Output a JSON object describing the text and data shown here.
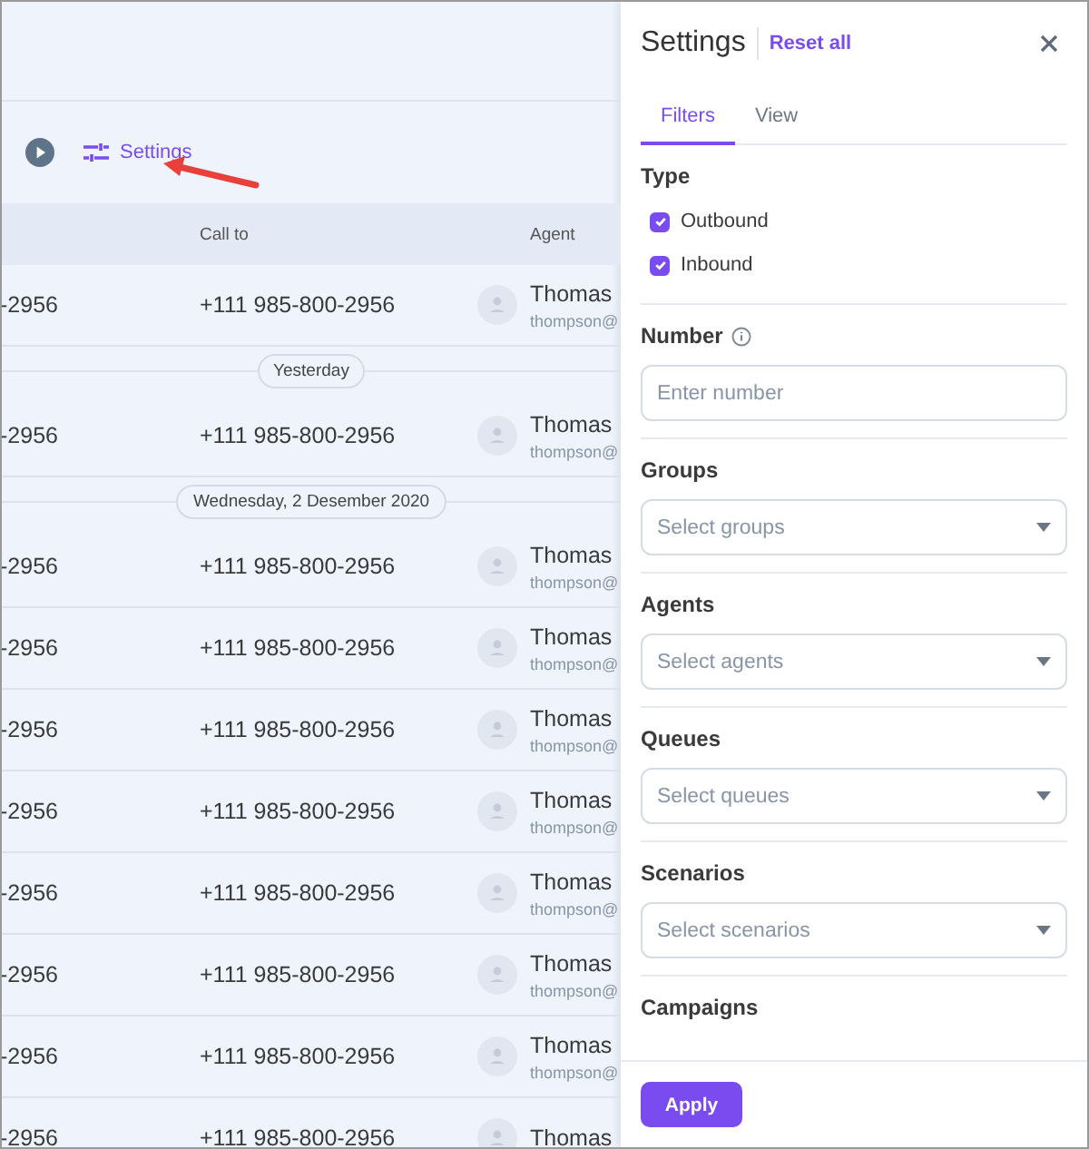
{
  "toolbar": {
    "settings_label": "Settings"
  },
  "table": {
    "columns": [
      "Call to",
      "Agent"
    ],
    "rows": [
      {
        "kind": "row",
        "column_1": "-2956",
        "call_to": "+111 985-800-2956",
        "agent_name": "Thomas",
        "agent_email": "thompson@"
      },
      {
        "kind": "divider",
        "label": "Yesterday"
      },
      {
        "kind": "row",
        "column_1": "-2956",
        "call_to": "+111 985-800-2956",
        "agent_name": "Thomas",
        "agent_email": "thompson@"
      },
      {
        "kind": "divider",
        "label": "Wednesday, 2 Desember 2020"
      },
      {
        "kind": "row",
        "column_1": "-2956",
        "call_to": "+111 985-800-2956",
        "agent_name": "Thomas",
        "agent_email": "thompson@"
      },
      {
        "kind": "row",
        "column_1": "-2956",
        "call_to": "+111 985-800-2956",
        "agent_name": "Thomas",
        "agent_email": "thompson@"
      },
      {
        "kind": "row",
        "column_1": "-2956",
        "call_to": "+111 985-800-2956",
        "agent_name": "Thomas",
        "agent_email": "thompson@"
      },
      {
        "kind": "row",
        "column_1": "-2956",
        "call_to": "+111 985-800-2956",
        "agent_name": "Thomas",
        "agent_email": "thompson@"
      },
      {
        "kind": "row",
        "column_1": "-2956",
        "call_to": "+111 985-800-2956",
        "agent_name": "Thomas",
        "agent_email": "thompson@"
      },
      {
        "kind": "row",
        "column_1": "-2956",
        "call_to": "+111 985-800-2956",
        "agent_name": "Thomas",
        "agent_email": "thompson@"
      },
      {
        "kind": "row",
        "column_1": "-2956",
        "call_to": "+111 985-800-2956",
        "agent_name": "Thomas",
        "agent_email": "thompson@"
      },
      {
        "kind": "row",
        "column_1": "-2956",
        "call_to": "+111 985-800-2956",
        "agent_name": "Thomas"
      }
    ]
  },
  "panel": {
    "title": "Settings",
    "reset": "Reset all",
    "tabs": [
      {
        "label": "Filters",
        "selected": true
      },
      {
        "label": "View",
        "selected": false
      }
    ],
    "sections": [
      {
        "kind": "checkboxes",
        "label": "Type",
        "options": [
          {
            "label": "Outbound",
            "checked": true
          },
          {
            "label": "Inbound",
            "checked": true
          }
        ]
      },
      {
        "kind": "input",
        "label": "Number",
        "info": true,
        "placeholder": "Enter number"
      },
      {
        "kind": "select",
        "label": "Groups",
        "placeholder": "Select groups"
      },
      {
        "kind": "select",
        "label": "Agents",
        "placeholder": "Select agents"
      },
      {
        "kind": "select",
        "label": "Queues",
        "placeholder": "Select queues"
      },
      {
        "kind": "select",
        "label": "Scenarios",
        "placeholder": "Select scenarios"
      },
      {
        "kind": "heading",
        "label": "Campaigns"
      }
    ],
    "apply": "Apply"
  }
}
